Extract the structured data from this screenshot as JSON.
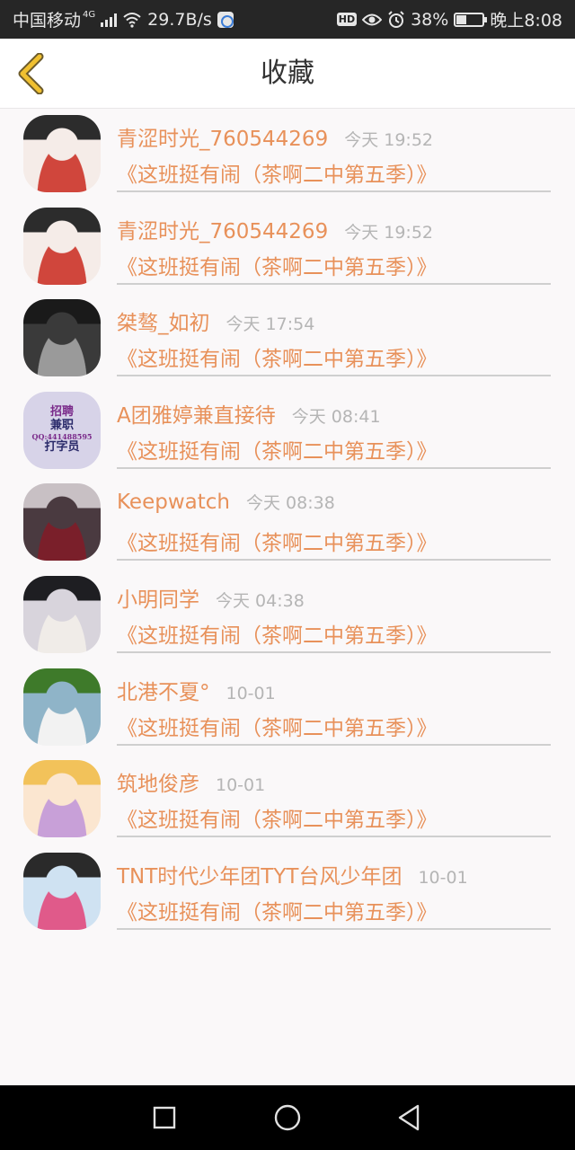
{
  "status_bar": {
    "carrier": "中国移动",
    "network": "4G",
    "speed": "29.7B/s",
    "hd": "HD",
    "battery": "38%",
    "battery_level": 0.38,
    "time": "晚上8:08"
  },
  "header": {
    "title": "收藏",
    "back_icon": "chevron-left-icon"
  },
  "favorites": [
    {
      "name": "青涩时光_760544269",
      "time": "今天 19:52",
      "work": "《这班挺有闹（茶啊二中第五季）》",
      "avatar_colors": [
        "#f5ece8",
        "#2c2c2c",
        "#d0463c"
      ]
    },
    {
      "name": "青涩时光_760544269",
      "time": "今天 19:52",
      "work": "《这班挺有闹（茶啊二中第五季）》",
      "avatar_colors": [
        "#f5ece8",
        "#2c2c2c",
        "#d0463c"
      ]
    },
    {
      "name": "桀骜_如初",
      "time": "今天 17:54",
      "work": "《这班挺有闹（茶啊二中第五季）》",
      "avatar_colors": [
        "#3a3a3a",
        "#1a1a1a",
        "#9a9a9a"
      ]
    },
    {
      "name": "A团雅婷兼直接待",
      "time": "今天 08:41",
      "work": "《这班挺有闹（茶啊二中第五季）》",
      "avatar_colors": [
        "#d7d3e8",
        "#7a2a8a",
        "#2a2a6a"
      ],
      "avatar_text": [
        "招聘",
        "兼职",
        "QQ:441488595",
        "打字员"
      ]
    },
    {
      "name": "Keepwatch",
      "time": "今天 08:38",
      "work": "《这班挺有闹（茶啊二中第五季）》",
      "avatar_colors": [
        "#4a3a40",
        "#c8c0c4",
        "#7a1f2a"
      ]
    },
    {
      "name": "小明同学",
      "time": "今天 04:38",
      "work": "《这班挺有闹（茶啊二中第五季）》",
      "avatar_colors": [
        "#d8d4dc",
        "#1e1e22",
        "#f0ece8"
      ]
    },
    {
      "name": "北港不夏°",
      "time": "10-01",
      "work": "《这班挺有闹（茶啊二中第五季）》",
      "avatar_colors": [
        "#8fb4c8",
        "#3e7a2a",
        "#f2f2f2"
      ]
    },
    {
      "name": "筑地俊彦",
      "time": "10-01",
      "work": "《这班挺有闹（茶啊二中第五季）》",
      "avatar_colors": [
        "#fbe6d0",
        "#f2c25a",
        "#c8a0d8"
      ]
    },
    {
      "name": "TNT时代少年团TYT台风少年团",
      "time": "10-01",
      "work": "《这班挺有闹（茶啊二中第五季）》",
      "avatar_colors": [
        "#cfe2f2",
        "#2a2a2a",
        "#e05a8a"
      ]
    }
  ],
  "nav_bar": {
    "recent_icon": "square-icon",
    "home_icon": "circle-icon",
    "back_icon": "triangle-back-icon"
  },
  "colors": {
    "accent": "#e8915a",
    "back_arrow": "#f0c030",
    "muted": "#b5b5b5"
  }
}
